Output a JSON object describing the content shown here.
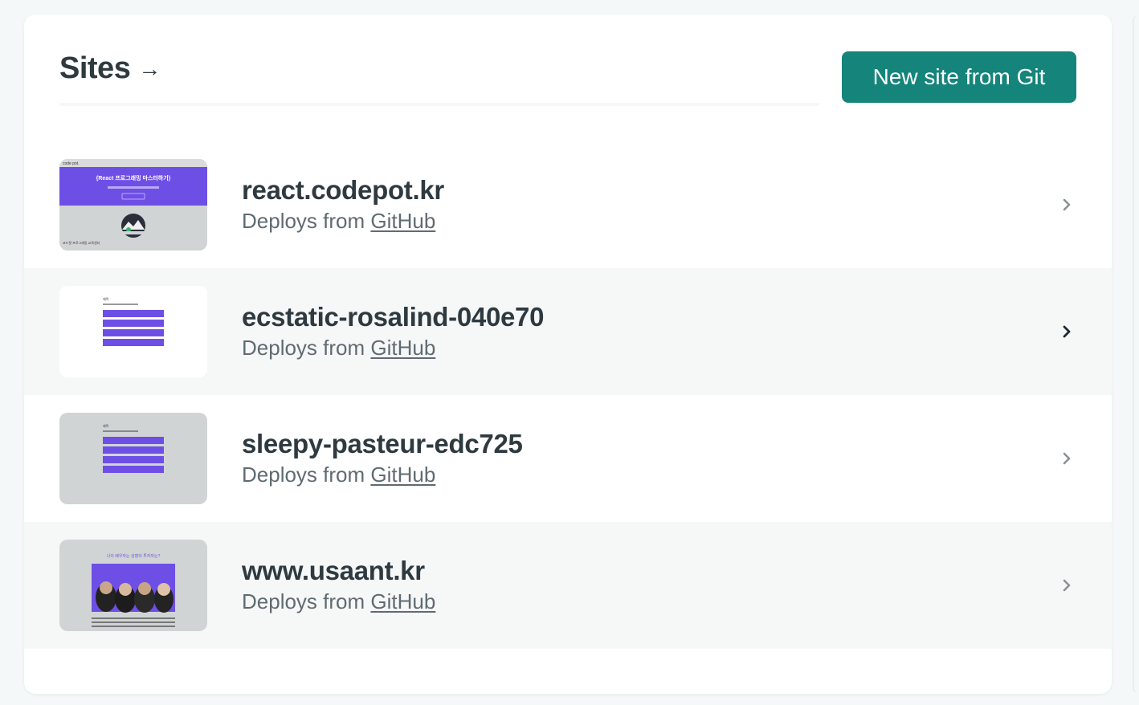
{
  "header": {
    "title": "Sites",
    "title_arrow": "→",
    "new_site_button": "New site from Git"
  },
  "sites": [
    {
      "name": "react.codepot.kr",
      "deploy_prefix": "Deploys from",
      "provider": "GitHub",
      "thumbnail": {
        "top_label": "code pot.",
        "banner_title": "{React 프로그래밍 마스터하기}",
        "footer_note": "코드팟 프로그래밍 교육센터"
      }
    },
    {
      "name": "ecstatic-rosalind-040e70",
      "deploy_prefix": "Deploys from",
      "provider": "GitHub",
      "thumbnail": {
        "top_label": "제목"
      }
    },
    {
      "name": "sleepy-pasteur-edc725",
      "deploy_prefix": "Deploys from",
      "provider": "GitHub",
      "thumbnail": {
        "top_label": "제목"
      }
    },
    {
      "name": "www.usaant.kr",
      "deploy_prefix": "Deploys from",
      "provider": "GitHub",
      "thumbnail": {
        "headline": "나의 배우자는 성향의 투자자는?"
      }
    }
  ],
  "colors": {
    "accent": "#15847b",
    "thumb_purple": "#6e4fe6",
    "thumb_gray": "#d1d4d5"
  },
  "icons": [
    "arrow-right-icon",
    "chevron-right-icon"
  ]
}
